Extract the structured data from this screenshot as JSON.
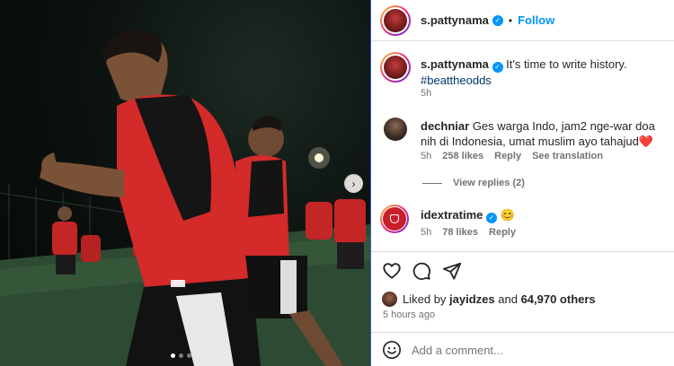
{
  "post": {
    "author": "s.pattynama",
    "follow_label": "Follow",
    "caption_text": "It's time to write history.",
    "hashtag": "#beattheodds",
    "caption_time": "5h"
  },
  "comments": [
    {
      "username": "dechniar",
      "text": "Ges warga Indo, jam2 nge-war doa nih di Indonesia, umat muslim ayo tahajud❤️",
      "time": "5h",
      "likes": "258 likes",
      "reply": "Reply",
      "translate": "See translation",
      "view_replies": "View replies (2)"
    },
    {
      "username": "idextratime",
      "text": "😊",
      "time": "5h",
      "likes": "78 likes",
      "reply": "Reply"
    }
  ],
  "likes": {
    "prefix": "Liked by ",
    "user": "jayidzes",
    "middle": " and ",
    "count": "64,970 others"
  },
  "timestamp": "5 hours ago",
  "add_comment": {
    "placeholder": "Add a comment..."
  },
  "colors": {
    "accent": "#0095f6",
    "jersey_red": "#d42a2a",
    "divider_blue": "#3b5bd6"
  },
  "carousel": {
    "total": 3,
    "active": 1
  }
}
